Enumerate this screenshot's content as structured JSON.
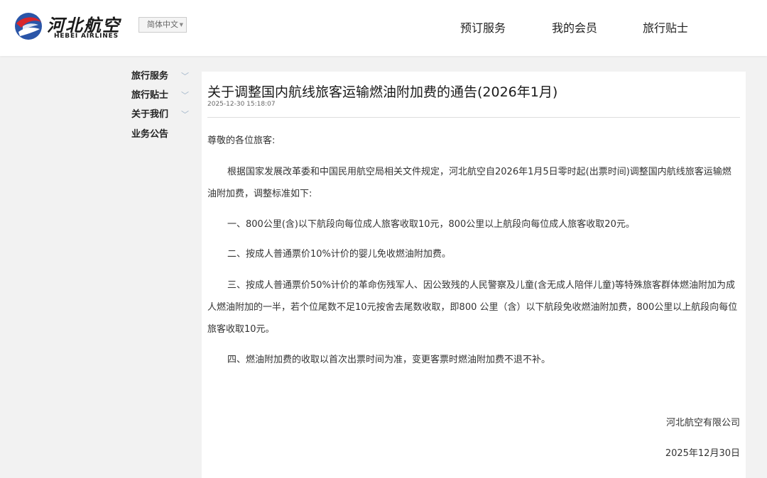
{
  "header": {
    "logo_cn": "河北航空",
    "logo_en": "HEBEI AIRLINES",
    "language": "简体中文",
    "nav": [
      "预订服务",
      "我的会员",
      "旅行贴士"
    ]
  },
  "sidebar": {
    "items": [
      {
        "label": "旅行服务",
        "has_chevron": true
      },
      {
        "label": "旅行贴士",
        "has_chevron": true
      },
      {
        "label": "关于我们",
        "has_chevron": true
      },
      {
        "label": "业务公告",
        "has_chevron": false
      }
    ]
  },
  "article": {
    "title": "关于调整国内航线旅客运输燃油附加费的通告(2026年1月)",
    "timestamp": "2025-12-30 15:18:07",
    "greeting": "尊敬的各位旅客:",
    "intro": "根据国家发展改革委和中国民用航空局相关文件规定，河北航空自2026年1月5日零时起(出票时间)调整国内航线旅客运输燃油附加费，调整标准如下:",
    "items": [
      "一、800公里(含)以下航段向每位成人旅客收取10元，800公里以上航段向每位成人旅客收取20元。",
      "二、按成人普通票价10%计价的婴儿免收燃油附加费。",
      "三、按成人普通票价50%计价的革命伤残军人、因公致残的人民警察及儿童(含无成人陪伴儿童)等特殊旅客群体燃油附加为成人燃油附加的一半，若个位尾数不足10元按舍去尾数收取，即800 公里（含）以下航段免收燃油附加费，800公里以上航段向每位旅客收取10元。",
      "四、燃油附加费的收取以首次出票时间为准，变更客票时燃油附加费不退不补。"
    ],
    "signature_org": "河北航空有限公司",
    "signature_date": "2025年12月30日"
  }
}
